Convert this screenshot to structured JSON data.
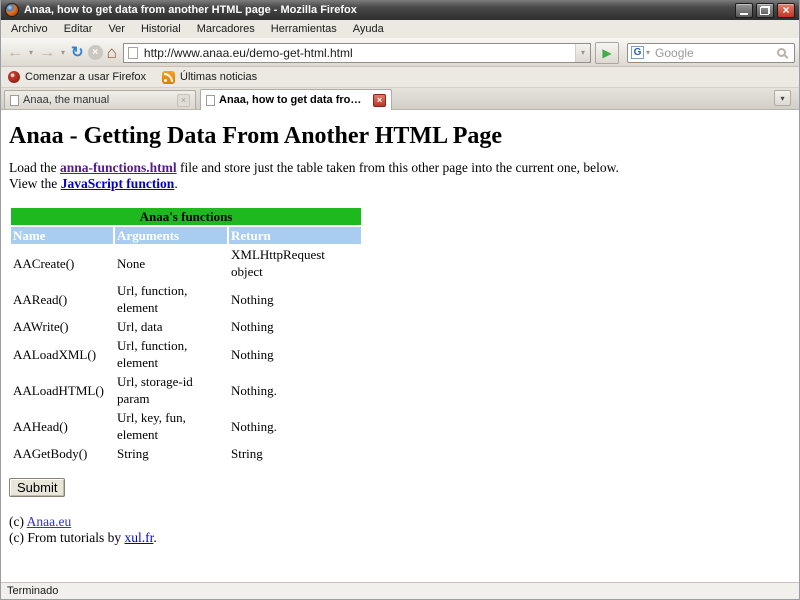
{
  "window": {
    "title": "Anaa, how to get data from another HTML page - Mozilla Firefox"
  },
  "menubar": {
    "items": [
      "Archivo",
      "Editar",
      "Ver",
      "Historial",
      "Marcadores",
      "Herramientas",
      "Ayuda"
    ]
  },
  "navbar": {
    "url": "http://www.anaa.eu/demo-get-html.html",
    "search_placeholder": "Google"
  },
  "bookmarks": {
    "items": [
      "Comenzar a usar Firefox",
      "Últimas noticias"
    ]
  },
  "tabs": [
    {
      "label": "Anaa, the manual",
      "active": false
    },
    {
      "label": "Anaa, how to get data from anot...",
      "active": true
    }
  ],
  "icons": {
    "back": "←",
    "forward": "→",
    "reload": "↻",
    "stop": "×",
    "home": "⌂",
    "dropdown": "▾",
    "go": "▶",
    "google_letter": "G",
    "close": "×",
    "tab_close": "×"
  },
  "page": {
    "heading": "Anaa - Getting Data From Another HTML Page",
    "para1_pre": "Load the ",
    "para1_link": "anna-functions.html",
    "para1_post": " file and store just the table taken from this other page into the current one, below.",
    "para2_pre": "View the ",
    "para2_link": "JavaScript function",
    "para2_post": ".",
    "table": {
      "caption": "Anaa's functions",
      "headers": [
        "Name",
        "Arguments",
        "Return"
      ],
      "rows": [
        [
          "AACreate()",
          "None",
          "XMLHttpRequest object"
        ],
        [
          "AARead()",
          "Url, function, element",
          "Nothing"
        ],
        [
          "AAWrite()",
          "Url, data",
          "Nothing"
        ],
        [
          "AALoadXML()",
          "Url, function, element",
          "Nothing"
        ],
        [
          "AALoadHTML()",
          "Url, storage-id param",
          "Nothing."
        ],
        [
          "AAHead()",
          "Url, key, fun, element",
          "Nothing."
        ],
        [
          "AAGetBody()",
          "String",
          "String"
        ]
      ]
    },
    "submit_label": "Submit",
    "footer1_pre": "(c) ",
    "footer1_link": "Anaa.eu",
    "footer2_pre": "(c) From tutorials by ",
    "footer2_link": "xul.fr",
    "footer2_post": "."
  },
  "statusbar": {
    "text": "Terminado"
  },
  "colors": {
    "table_caption_bg": "#1EB91E",
    "table_header_bg": "#A8CDF0",
    "link_blue": "#0000CC",
    "link_visited": "#551A8B",
    "titlebar_bg": "#3F3F3F",
    "close_button_red": "#C03527",
    "go_arrow_green": "#3FAE49",
    "rss_orange": "#E98300"
  }
}
